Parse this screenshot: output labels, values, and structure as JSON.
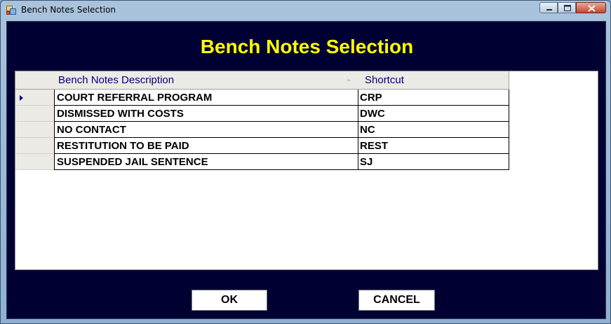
{
  "window": {
    "title": "Bench Notes Selection",
    "icon": "form-icon"
  },
  "heading": "Bench Notes Selection",
  "grid": {
    "columns": {
      "description": "Bench Notes Description",
      "shortcut": "Shortcut"
    },
    "sort_column": "description",
    "current_row": 0,
    "rows": [
      {
        "description": "COURT REFERRAL PROGRAM",
        "shortcut": "CRP"
      },
      {
        "description": "DISMISSED WITH COSTS",
        "shortcut": "DWC"
      },
      {
        "description": "NO CONTACT",
        "shortcut": "NC"
      },
      {
        "description": "RESTITUTION TO BE PAID",
        "shortcut": "REST"
      },
      {
        "description": "SUSPENDED JAIL SENTENCE",
        "shortcut": "SJ"
      }
    ]
  },
  "buttons": {
    "ok": "OK",
    "cancel": "CANCEL"
  },
  "colors": {
    "client_background": "#000033",
    "heading": "#ffff00",
    "header_text": "#000080"
  }
}
